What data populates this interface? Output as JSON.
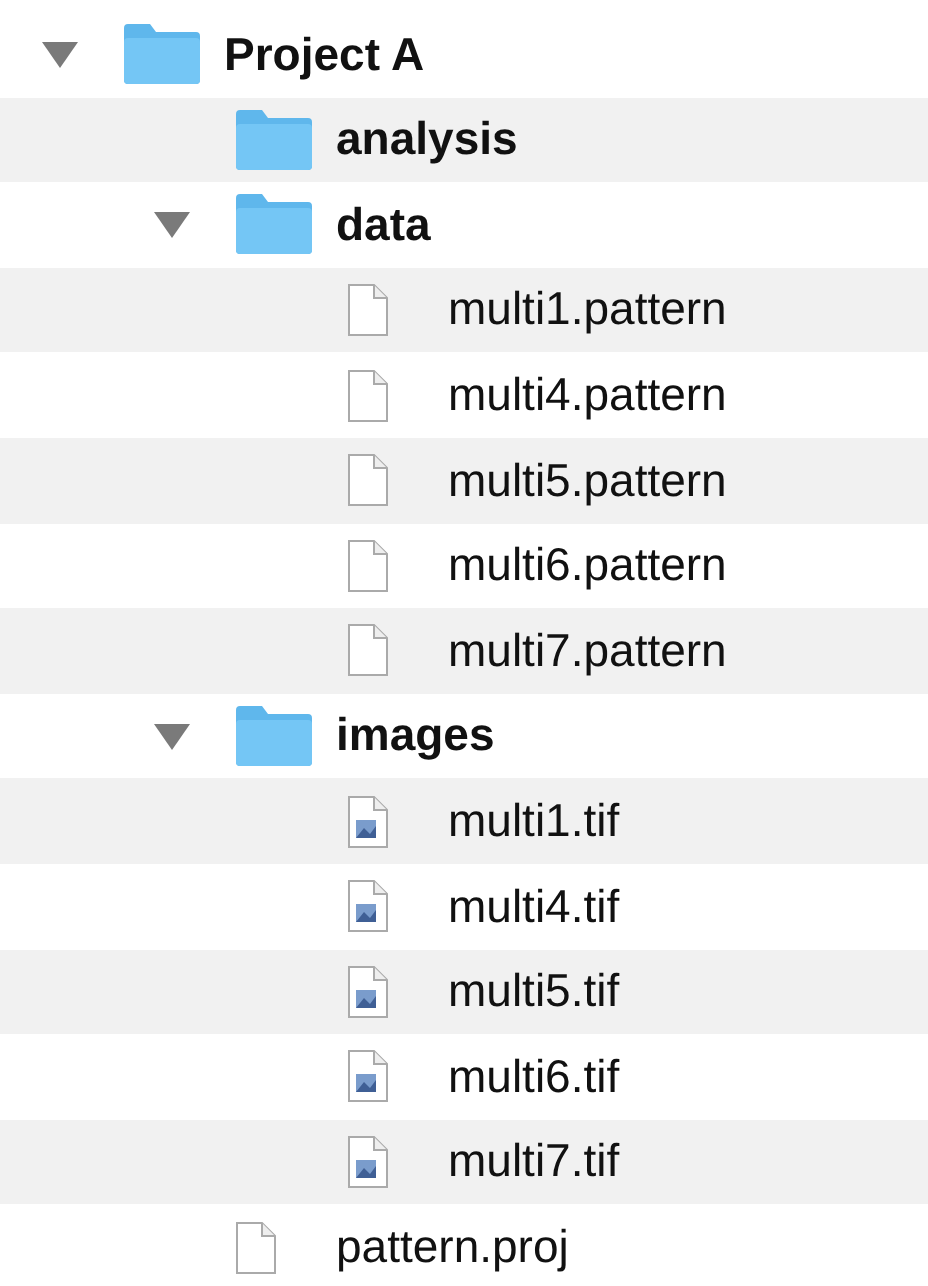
{
  "tree": [
    {
      "name": "Project A",
      "kind": "folder",
      "expanded": true,
      "children": [
        {
          "name": "analysis",
          "kind": "folder"
        },
        {
          "name": "data",
          "kind": "folder",
          "expanded": true,
          "children": [
            {
              "name": "multi1.pattern",
              "kind": "document"
            },
            {
              "name": "multi4.pattern",
              "kind": "document"
            },
            {
              "name": "multi5.pattern",
              "kind": "document"
            },
            {
              "name": "multi6.pattern",
              "kind": "document"
            },
            {
              "name": "multi7.pattern",
              "kind": "document"
            }
          ]
        },
        {
          "name": "images",
          "kind": "folder",
          "expanded": true,
          "children": [
            {
              "name": "multi1.tif",
              "kind": "image"
            },
            {
              "name": "multi4.tif",
              "kind": "image"
            },
            {
              "name": "multi5.tif",
              "kind": "image"
            },
            {
              "name": "multi6.tif",
              "kind": "image"
            },
            {
              "name": "multi7.tif",
              "kind": "image"
            }
          ]
        },
        {
          "name": "pattern.proj",
          "kind": "document"
        }
      ]
    }
  ]
}
